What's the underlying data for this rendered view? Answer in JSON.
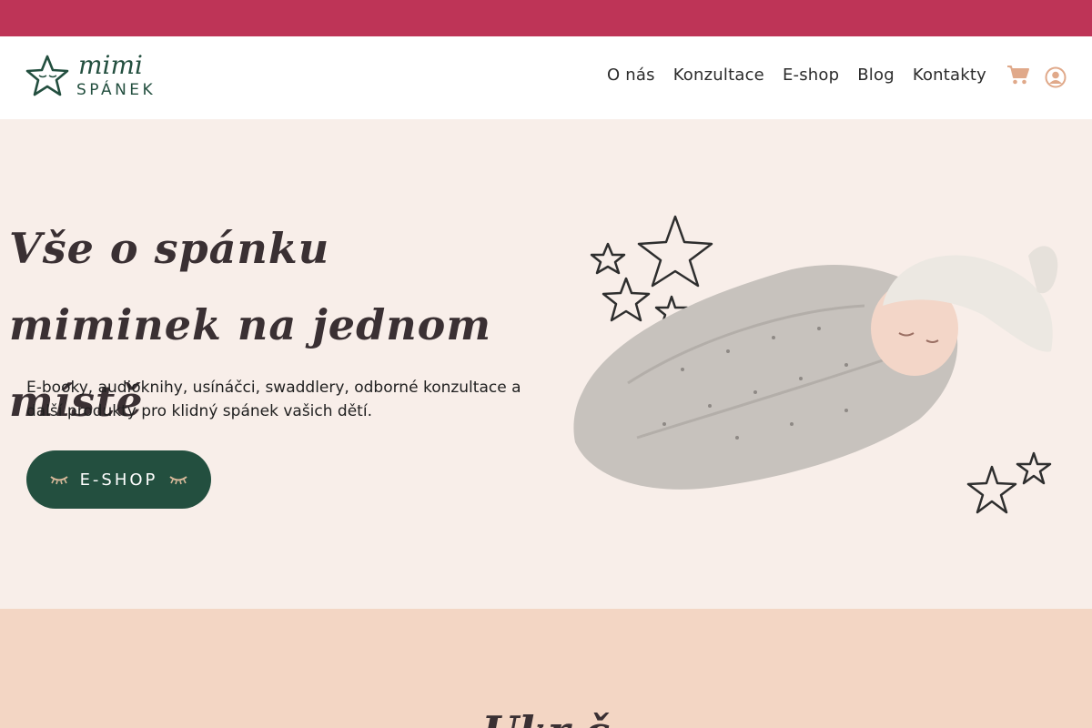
{
  "brand": {
    "logo_script": "mimi",
    "logo_word": "SPÁNEK",
    "green": "#234f3f",
    "accent_bar": "#be3457"
  },
  "nav": {
    "items": [
      {
        "label": "O nás"
      },
      {
        "label": "Konzultace"
      },
      {
        "label": "E-shop"
      },
      {
        "label": "Blog"
      },
      {
        "label": "Kontakty"
      }
    ],
    "cart_icon": "shopping-cart-icon",
    "account_icon": "user-circle-icon",
    "cart_color": "#e0a98a"
  },
  "hero": {
    "title": "Vše o spánku miminek na jednom místě",
    "text": "E-booky, audioknihy, usínáčci, swaddlery, odborné konzultace a další produkty pro klidný spánek vašich dětí.",
    "button_label": "E-SHOP",
    "background": "#f8eee9"
  },
  "section2": {
    "title_partial": "Ukr      č",
    "background": "#f3d6c4"
  }
}
